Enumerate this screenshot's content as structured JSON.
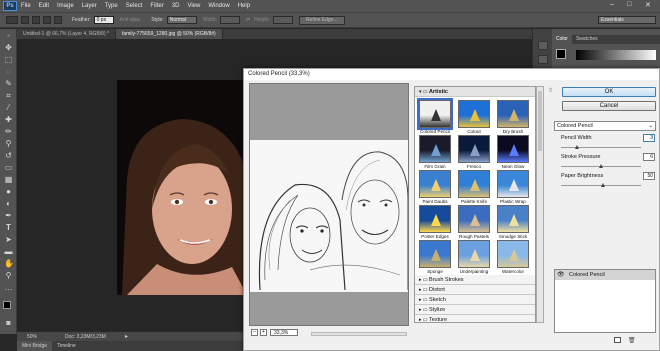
{
  "menubar": {
    "logo": "Ps",
    "items": [
      "File",
      "Edit",
      "Image",
      "Layer",
      "Type",
      "Select",
      "Filter",
      "3D",
      "View",
      "Window",
      "Help"
    ],
    "window_controls": [
      "–",
      "□",
      "✕"
    ]
  },
  "options": {
    "feather_label": "Feather:",
    "feather_value": "0 px",
    "antialias_label": "Anti-alias",
    "style_label": "Style:",
    "style_value": "Normal",
    "width_label": "Width:",
    "height_label": "Height:",
    "refine_button": "Refine Edge...",
    "workspace": "Essentials"
  },
  "tabs": [
    "Untitled-1 @ 66,7% (Layer 4, RGB/8) *",
    "family-775659_1280.jpg @ 50% (RGB/8#)"
  ],
  "status": {
    "zoom": "50%",
    "doc": "Doc: 3,23M/3,23M"
  },
  "bottom_tabs": [
    "Mini Bridge",
    "Timeline"
  ],
  "panels": {
    "color_tab": "Color",
    "swatches_tab": "Swatches"
  },
  "dialog": {
    "title": "Colored Pencil (33,3%)",
    "zoom_value": "33,3%",
    "ok_label": "OK",
    "cancel_label": "Cancel",
    "filter_select": "Colored Pencil",
    "params": [
      {
        "label": "Pencil Width",
        "value": "3"
      },
      {
        "label": "Stroke Pressure",
        "value": "6"
      },
      {
        "label": "Paper Brightness",
        "value": "50"
      }
    ],
    "layer_item": "Colored Pencil",
    "gallery": {
      "open_category": "Artistic",
      "thumbs": [
        "Colored Pencil",
        "Cutout",
        "Dry Brush",
        "Film Grain",
        "Fresco",
        "Neon Glow",
        "Paint Daubs",
        "Palette Knife",
        "Plastic Wrap",
        "Poster Edges",
        "Rough Pastels",
        "Smudge Stick",
        "Sponge",
        "Underpainting",
        "Watercolor"
      ],
      "categories": [
        "Brush Strokes",
        "Distort",
        "Sketch",
        "Stylize",
        "Texture"
      ]
    }
  }
}
